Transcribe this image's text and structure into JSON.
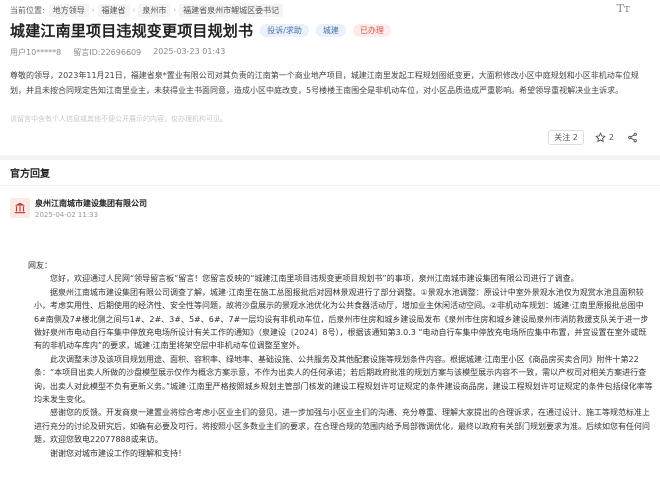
{
  "breadcrumb": {
    "prefix": "当前位置:",
    "items": [
      "地方领导",
      "福建省",
      "泉州市",
      "福建省泉州市鲤城区委书记"
    ]
  },
  "font_toggle": "Tт",
  "title": "城建江南里项目违规变更项目规划书",
  "tags": {
    "type": "投诉/求助",
    "domain": "城建",
    "status": "已办理"
  },
  "meta": {
    "user": "用户10*****8",
    "message_id": "留言ID:22696609",
    "time": "2025-03-23 01:43"
  },
  "content": "尊敬的领导，2023年11月21日，福建省泉*置业有限公司对其负责的江南第一个商业地产项目，城建江南里发起工程规划图纸变更，大面积修改小区中庭规划和小区非机动车位规划，并且未按合同规定告知江南里业主，未获得业主书面同意，造成小区中庭改变，5号楼楼王南围全是非机动车位，对小区品质造成严重影响。希望领导重视解决业主诉求。",
  "privacy_note": "该留言中含有个人信息或其他不便公开展示的内容，仅办理机构可见。",
  "actions": {
    "follow": "关注 2",
    "like_count": "2"
  },
  "reply": {
    "header": "官方回复",
    "org_name": "泉州江南城市建设集团有限公司",
    "org_time": "2025-04-02 11:33",
    "paragraphs": [
      "网友：",
      "您好，欢迎通过人民网“领导留言板”留言！您留言反映的“城建江南里项目违规变更项目规划书”的事项，泉州江南城市建设集团有限公司进行了调查。",
      "据泉州江南城市建设集团有限公司调查了解，城建·江南里在施工总图报批后对园林景观进行了部分调整。①景观水池调整：原设计中室外景观水池仅为观赏水池且面积较小，考虑实用性、后期使用的经济性、安全性等问题，故将沙盘展示的景观水池优化为公共食器活动厅，增加业主休闲活动空间。②非机动车规划：城建·江南里原报批总图中6#南侧及7#楼北侧之间与1#、2#、3#、5#、6#、7#一层均设有非机动车位，后泉州市住房和城乡建设局发布《泉州市住房和城乡建设局泉州市消防救援支队关于进一步做好泉州市电动自行车集中停放充电场所设计有关工作的通知》（泉建设〔2024〕8号），根据该通知第3.0.3 “电动自行车集中停放充电场所应集中布置，并宜设置在室外或既有的非机动车库内”的要求，城建·江南里将架空层中非机动车位调整至室外。",
      "此次调整未涉及该项目规划用途、面积、容积率、绿地率、基础设施、公共服务及其他配套设施等规划条件内容。根据城建·江南里小区《商品房买卖合同》附件十第22条：“本项目出卖人所做的沙盘模型展示仅作为概念方案示意，不作为出卖人的任何承诺；若后期政府批准的规划方案与该模型展示内容不一致，需以产权司对相关方案进行查询，出卖人对此模型不负有更新义务。”城建·江南里严格按照城乡规划主管部门核发的建设工程规划许可证规定的条件建设商品房，建设工程规划许可证规定的条件包括绿化率等均未发生变化。",
      "感谢您的反馈。开发商泉一建置业将综合考虑小区业主们的意见，进一步加强与小区业主们的沟通、充分尊重、理解大家提出的合理诉求，在通过设计、施工等规范标准上进行充分的讨论及研究后，如确有必要及可行，将按照小区多数业主们的要求，在合理合规的范围内给予局部微调优化，最终以政府有关部门规划要求为准。后续如您有任何问题，欢迎您致电22077888或来访。",
      "谢谢您对城市建设工作的理解和支持！"
    ]
  },
  "colors": {
    "accent": "#4a72a8",
    "status": "#d9534f",
    "background": "#f2f3f5"
  }
}
